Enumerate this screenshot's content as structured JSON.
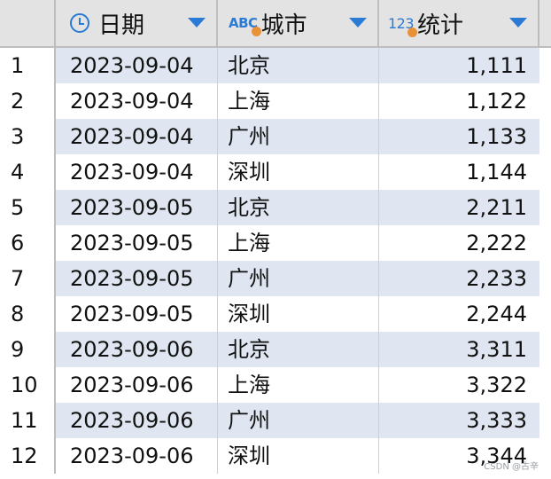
{
  "columns": [
    {
      "label": "日期",
      "icon": "clock-icon"
    },
    {
      "label": "城市",
      "icon": "text-type-icon",
      "type_glyph": "ABC"
    },
    {
      "label": "统计",
      "icon": "number-type-icon",
      "type_glyph": "123"
    }
  ],
  "rows": [
    {
      "n": "1",
      "date": "2023-09-04",
      "city": "北京",
      "stat": "1,111"
    },
    {
      "n": "2",
      "date": "2023-09-04",
      "city": "上海",
      "stat": "1,122"
    },
    {
      "n": "3",
      "date": "2023-09-04",
      "city": "广州",
      "stat": "1,133"
    },
    {
      "n": "4",
      "date": "2023-09-04",
      "city": "深圳",
      "stat": "1,144"
    },
    {
      "n": "5",
      "date": "2023-09-05",
      "city": "北京",
      "stat": "2,211"
    },
    {
      "n": "6",
      "date": "2023-09-05",
      "city": "上海",
      "stat": "2,222"
    },
    {
      "n": "7",
      "date": "2023-09-05",
      "city": "广州",
      "stat": "2,233"
    },
    {
      "n": "8",
      "date": "2023-09-05",
      "city": "深圳",
      "stat": "2,244"
    },
    {
      "n": "9",
      "date": "2023-09-06",
      "city": "北京",
      "stat": "3,311"
    },
    {
      "n": "10",
      "date": "2023-09-06",
      "city": "上海",
      "stat": "3,322"
    },
    {
      "n": "11",
      "date": "2023-09-06",
      "city": "广州",
      "stat": "3,333"
    },
    {
      "n": "12",
      "date": "2023-09-06",
      "city": "深圳",
      "stat": "3,344"
    }
  ],
  "watermark": "CSDN @古辛",
  "colors": {
    "accent": "#2a7ad6",
    "type_dot": "#e8913a",
    "alt_row": "#dfe6f1",
    "header_bg": "#e3e3e3"
  }
}
